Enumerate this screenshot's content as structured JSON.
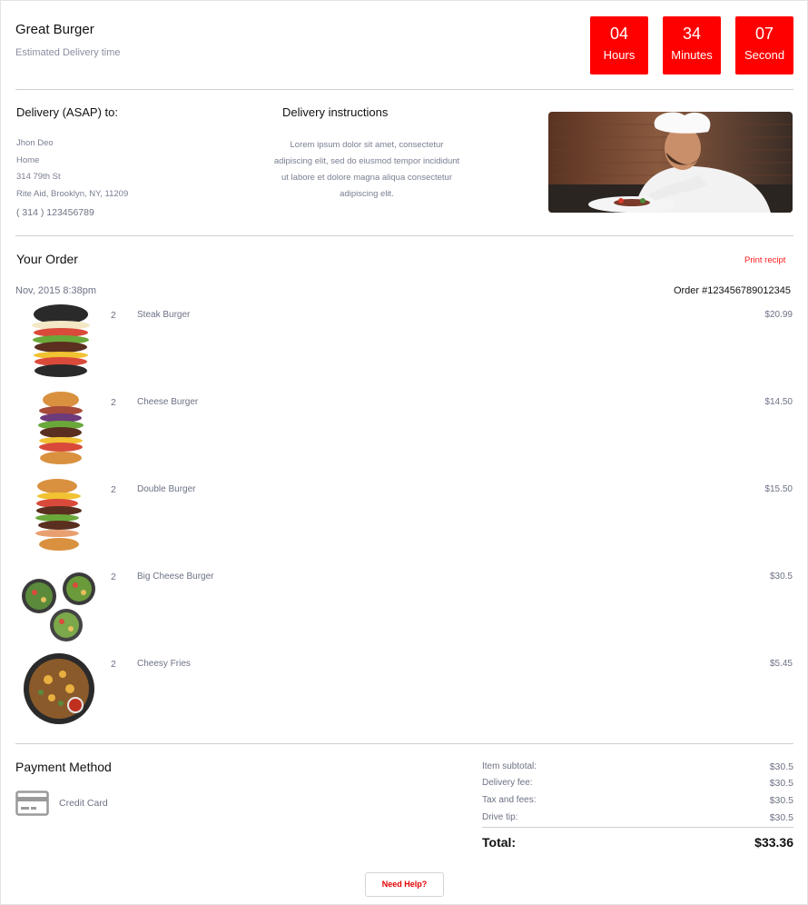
{
  "header": {
    "store_name": "Great Burger",
    "eta_label": "Estimated Delivery time",
    "timer": [
      {
        "value": "04",
        "unit": "Hours"
      },
      {
        "value": "34",
        "unit": "Minutes"
      },
      {
        "value": "07",
        "unit": "Second"
      }
    ]
  },
  "delivery": {
    "title": "Delivery (ASAP) to:",
    "name": "Jhon Deo",
    "place": "Home",
    "street": "314 79th St",
    "city": "Rite Aid, Brooklyn, NY, 11209",
    "phone": "( 314 ) 123456789"
  },
  "instructions": {
    "title": "Delivery instructions",
    "text": "Lorem ipsum dolor sit amet, consectetur adipiscing elit, sed do eiusmod tempor incididunt ut labore et dolore magna aliqua consectetur adipiscing elit."
  },
  "order": {
    "title": "Your Order",
    "print_label": "Print recipt",
    "date": "Nov, 2015 8:38pm",
    "number": "Order #123456789012345",
    "items": [
      {
        "qty": "2",
        "name": "Steak Burger",
        "price": "$20.99"
      },
      {
        "qty": "2",
        "name": "Cheese Burger",
        "price": "$14.50"
      },
      {
        "qty": "2",
        "name": "Double Burger",
        "price": "$15.50"
      },
      {
        "qty": "2",
        "name": "Big Cheese Burger",
        "price": "$30.5"
      },
      {
        "qty": "2",
        "name": "Cheesy Fries",
        "price": "$5.45"
      }
    ]
  },
  "payment": {
    "title": "Payment Method",
    "method": "Credit Card",
    "icon": "credit-card-icon"
  },
  "summary": {
    "subtotal_label": "Item subtotal:",
    "subtotal": "$30.5",
    "delivery_label": "Delivery fee:",
    "delivery": "$30.5",
    "tax_label": "Tax and fees:",
    "tax": "$30.5",
    "tip_label": "Drive tip:",
    "tip": "$30.5",
    "total_label": "Total:",
    "total": "$33.36"
  },
  "help_label": "Need Help?",
  "colors": {
    "accent": "#ff0000",
    "muted": "#7a7f92",
    "divider": "#cfcfcf"
  }
}
